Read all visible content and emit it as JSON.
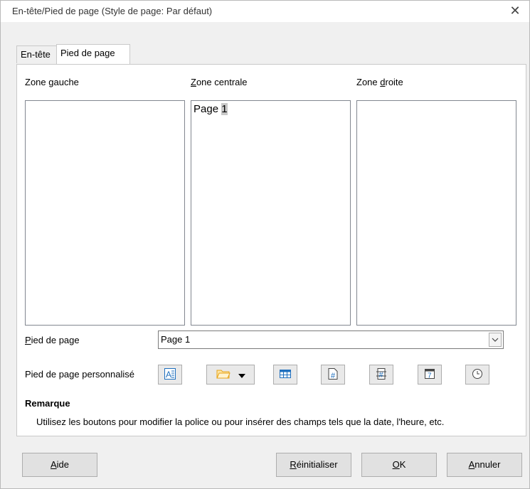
{
  "window": {
    "title": "En-tête/Pied de page (Style de page: Par défaut)"
  },
  "tabs": [
    {
      "label": "En-tête"
    },
    {
      "label": "Pied de page"
    }
  ],
  "zones": {
    "left": {
      "label_pre": "Zone ",
      "label_key": "g",
      "label_post": "auche"
    },
    "center": {
      "label_key": "Z",
      "label_post": "one centrale",
      "text_before": "Page ",
      "text_field": "1"
    },
    "right": {
      "label_pre": "Zone ",
      "label_key": "d",
      "label_post": "roite"
    }
  },
  "footer": {
    "label_key": "P",
    "label_post": "ied de page",
    "value": "Page 1"
  },
  "custom": {
    "label": "Pied de page personnalisé"
  },
  "toolbar": [
    {
      "name": "text-attributes-icon"
    },
    {
      "name": "folder-dropdown-icon"
    },
    {
      "name": "insert-table-icon"
    },
    {
      "name": "page-number-icon"
    },
    {
      "name": "page-count-icon"
    },
    {
      "name": "date-icon"
    },
    {
      "name": "time-icon"
    }
  ],
  "note": {
    "heading": "Remarque",
    "text": "Utilisez les boutons pour modifier la police ou pour insérer des champs tels que la date, l'heure, etc."
  },
  "buttons": {
    "help": {
      "key": "A",
      "rest": "ide"
    },
    "reset": {
      "key": "R",
      "rest": "éinitialiser"
    },
    "ok": {
      "key": "O",
      "rest": "K"
    },
    "cancel": {
      "key": "A",
      "rest": "nnuler"
    }
  },
  "colors": {
    "accent": "#1e6fbe",
    "folder": "#e8a317"
  }
}
